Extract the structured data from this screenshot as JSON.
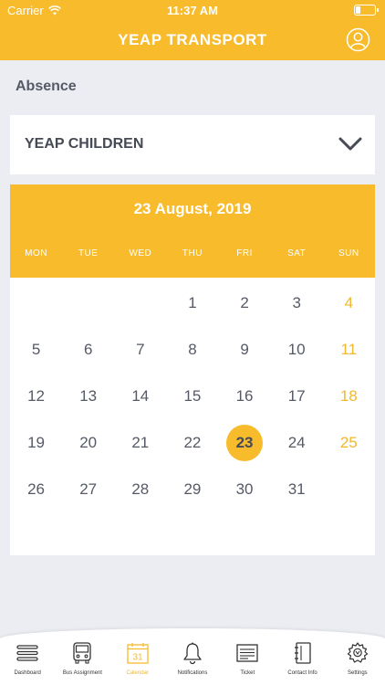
{
  "status": {
    "carrier": "Carrier",
    "time": "11:37 AM"
  },
  "nav": {
    "title": "YEAP TRANSPORT"
  },
  "section": {
    "title": "Absence"
  },
  "dropdown": {
    "label": "YEAP CHILDREN"
  },
  "calendar": {
    "title": "23 August, 2019",
    "weekdays": [
      "MON",
      "TUE",
      "WED",
      "THU",
      "FRI",
      "SAT",
      "SUN"
    ],
    "selected_day": 23,
    "leading_blanks": 3,
    "days": [
      "1",
      "2",
      "3",
      "4",
      "5",
      "6",
      "7",
      "8",
      "9",
      "10",
      "11",
      "12",
      "13",
      "14",
      "15",
      "16",
      "17",
      "18",
      "19",
      "20",
      "21",
      "22",
      "23",
      "24",
      "25",
      "26",
      "27",
      "28",
      "29",
      "30",
      "31"
    ]
  },
  "tabs": [
    {
      "label": "Dashboard",
      "icon": "menu-icon"
    },
    {
      "label": "Bus Assignment",
      "icon": "bus-icon"
    },
    {
      "label": "Calendar",
      "icon": "calendar-icon",
      "active": true,
      "icon_text": "31"
    },
    {
      "label": "Notifications",
      "icon": "bell-icon"
    },
    {
      "label": "Ticket",
      "icon": "ticket-icon"
    },
    {
      "label": "Contact Info",
      "icon": "notebook-icon"
    },
    {
      "label": "Settings",
      "icon": "gear-icon"
    }
  ],
  "colors": {
    "accent": "#f7bb2c",
    "background": "#ebedf2",
    "text": "#555a66"
  }
}
